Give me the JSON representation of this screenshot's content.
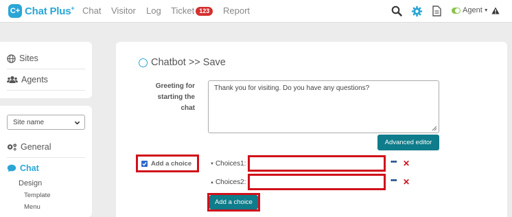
{
  "header": {
    "logo_badge": "C+",
    "logo_text": "Chat Plus",
    "logo_plus": "+",
    "nav": [
      {
        "label": "Chat"
      },
      {
        "label": "Visitor"
      },
      {
        "label": "Log"
      },
      {
        "label": "Ticket",
        "badge": "123"
      },
      {
        "label": "Report"
      }
    ],
    "agent_label": "Agent"
  },
  "sidebar": {
    "top_items": [
      {
        "label": "Sites",
        "icon": "globe-icon"
      },
      {
        "label": "Agents",
        "icon": "users-icon"
      }
    ],
    "site_select": "Site name",
    "general": "General",
    "chat": "Chat",
    "design": "Design",
    "template": "Template",
    "menu": "Menu"
  },
  "main": {
    "title": "Chatbot >> Save",
    "greeting_label": "Greeting for starting the chat",
    "greeting_value": "Thank you for visiting. Do you have any questions?",
    "advanced_editor": "Advanced editor",
    "add_choice_check_label": "Add a choice",
    "choices": [
      {
        "label": "Choices1:",
        "value": ""
      },
      {
        "label": "Choices2:",
        "value": ""
      }
    ],
    "add_choice_button": "Add a choice"
  },
  "colors": {
    "accent": "#2aa6d6",
    "button": "#0e7c8a",
    "highlight": "#d0101a",
    "badge": "#d43030"
  }
}
